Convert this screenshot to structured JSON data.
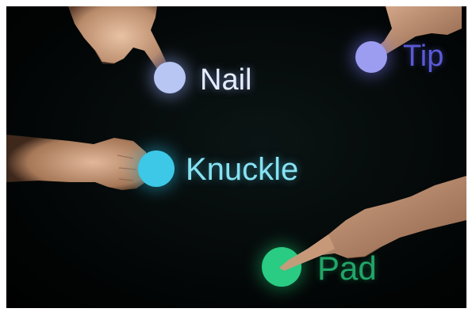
{
  "labels": {
    "nail": "Nail",
    "tip": "Tip",
    "knuckle": "Knuckle",
    "pad": "Pad"
  },
  "colors": {
    "nail_dot": "#b8c6f4",
    "nail_text": "#e4ecff",
    "tip_dot": "#9c9cf0",
    "tip_text": "#5a5ad6",
    "knuckle_dot": "#3cc8e6",
    "knuckle_text": "#86e2f2",
    "pad_dot": "#2acb82",
    "pad_text": "#21a668",
    "background": "#030707",
    "skin": "#c99a7a"
  },
  "icons": {
    "touch_point": "filled-circle"
  }
}
